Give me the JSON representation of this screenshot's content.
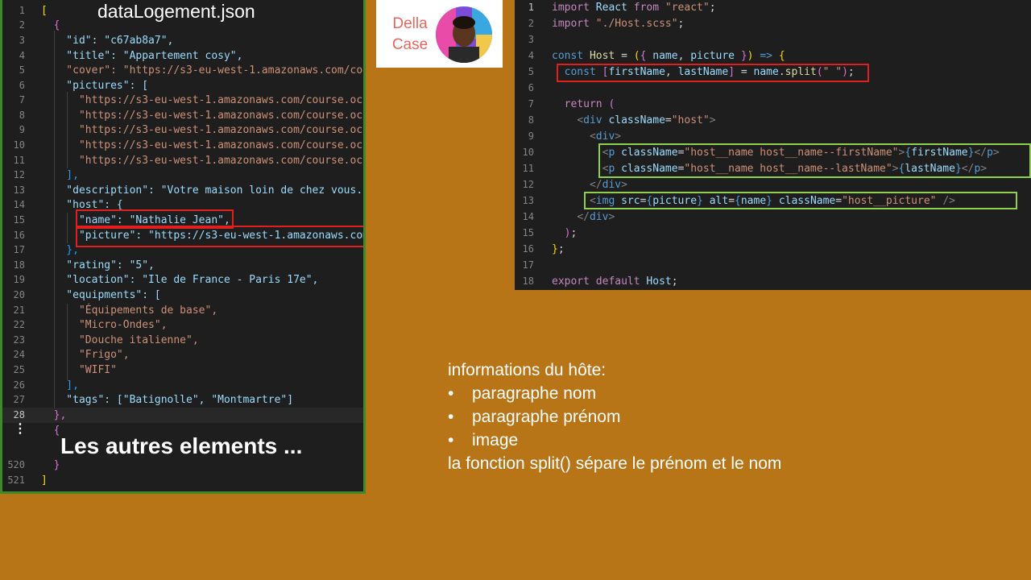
{
  "json_panel": {
    "title": "dataLogement.json",
    "lines": [
      {
        "n": "1",
        "code": "["
      },
      {
        "n": "2",
        "code": "  {"
      },
      {
        "n": "3",
        "code": "    \"id\": \"c67ab8a7\","
      },
      {
        "n": "4",
        "code": "    \"title\": \"Appartement cosy\","
      },
      {
        "n": "5",
        "code": "    \"cover\": \"https://s3-eu-west-1.amazonaws.com/cou"
      },
      {
        "n": "6",
        "code": "    \"pictures\": ["
      },
      {
        "n": "7",
        "code": "      \"https://s3-eu-west-1.amazonaws.com/course.oc-"
      },
      {
        "n": "8",
        "code": "      \"https://s3-eu-west-1.amazonaws.com/course.oc-"
      },
      {
        "n": "9",
        "code": "      \"https://s3-eu-west-1.amazonaws.com/course.oc-"
      },
      {
        "n": "10",
        "code": "      \"https://s3-eu-west-1.amazonaws.com/course.oc-"
      },
      {
        "n": "11",
        "code": "      \"https://s3-eu-west-1.amazonaws.com/course.oc-"
      },
      {
        "n": "12",
        "code": "    ],"
      },
      {
        "n": "13",
        "code": "    \"description\": \"Votre maison loin de chez vous."
      },
      {
        "n": "14",
        "code": "    \"host\": {"
      },
      {
        "n": "15",
        "code": "      \"name\": \"Nathalie Jean\","
      },
      {
        "n": "16",
        "code": "      \"picture\": \"https://s3-eu-west-1.amazonaws.com"
      },
      {
        "n": "17",
        "code": "    },"
      },
      {
        "n": "18",
        "code": "    \"rating\": \"5\","
      },
      {
        "n": "19",
        "code": "    \"location\": \"Ile de France - Paris 17e\","
      },
      {
        "n": "20",
        "code": "    \"equipments\": ["
      },
      {
        "n": "21",
        "code": "      \"Équipements de base\","
      },
      {
        "n": "22",
        "code": "      \"Micro-Ondes\","
      },
      {
        "n": "23",
        "code": "      \"Douche italienne\","
      },
      {
        "n": "24",
        "code": "      \"Frigo\","
      },
      {
        "n": "25",
        "code": "      \"WIFI\""
      },
      {
        "n": "26",
        "code": "    ],"
      },
      {
        "n": "27",
        "code": "    \"tags\": [\"Batignolle\", \"Montmartre\"]"
      },
      {
        "n": "28",
        "code": "  },"
      },
      {
        "n": "",
        "code": "  {"
      },
      {
        "n": "520",
        "code": "  }"
      },
      {
        "n": "521",
        "code": "]"
      }
    ],
    "ellipsis_text": "Les autres elements ..."
  },
  "code_panel": {
    "lines": [
      {
        "n": "1",
        "code": "import React from \"react\";"
      },
      {
        "n": "2",
        "code": "import \"./Host.scss\";"
      },
      {
        "n": "3",
        "code": ""
      },
      {
        "n": "4",
        "code": "const Host = ({ name, picture }) => {"
      },
      {
        "n": "5",
        "code": "  const [firstName, lastName] = name.split(\" \");"
      },
      {
        "n": "6",
        "code": ""
      },
      {
        "n": "7",
        "code": "  return ("
      },
      {
        "n": "8",
        "code": "    <div className=\"host\">"
      },
      {
        "n": "9",
        "code": "      <div>"
      },
      {
        "n": "10",
        "code": "        <p className=\"host__name host__name--firstName\">{firstName}</p>"
      },
      {
        "n": "11",
        "code": "        <p className=\"host__name host__name--lastName\">{lastName}</p>"
      },
      {
        "n": "12",
        "code": "      </div>"
      },
      {
        "n": "13",
        "code": "      <img src={picture} alt={name} className=\"host__picture\" />"
      },
      {
        "n": "14",
        "code": "    </div>"
      },
      {
        "n": "15",
        "code": "  );"
      },
      {
        "n": "16",
        "code": "};"
      },
      {
        "n": "17",
        "code": ""
      },
      {
        "n": "18",
        "code": "export default Host;"
      }
    ]
  },
  "logo": {
    "line1": "Della",
    "line2": "Case"
  },
  "notes": {
    "heading": "informations du hôte:",
    "bullets": [
      "paragraphe nom",
      "paragraphe prénom",
      "image"
    ],
    "footer": "la fonction split() sépare le prénom et le nom"
  },
  "colors": {
    "background": "#b87517",
    "editor": "#1e1e1e",
    "red_highlight": "#e0201e",
    "green_highlight": "#8fd14f",
    "json_border": "#3c8a2a"
  }
}
